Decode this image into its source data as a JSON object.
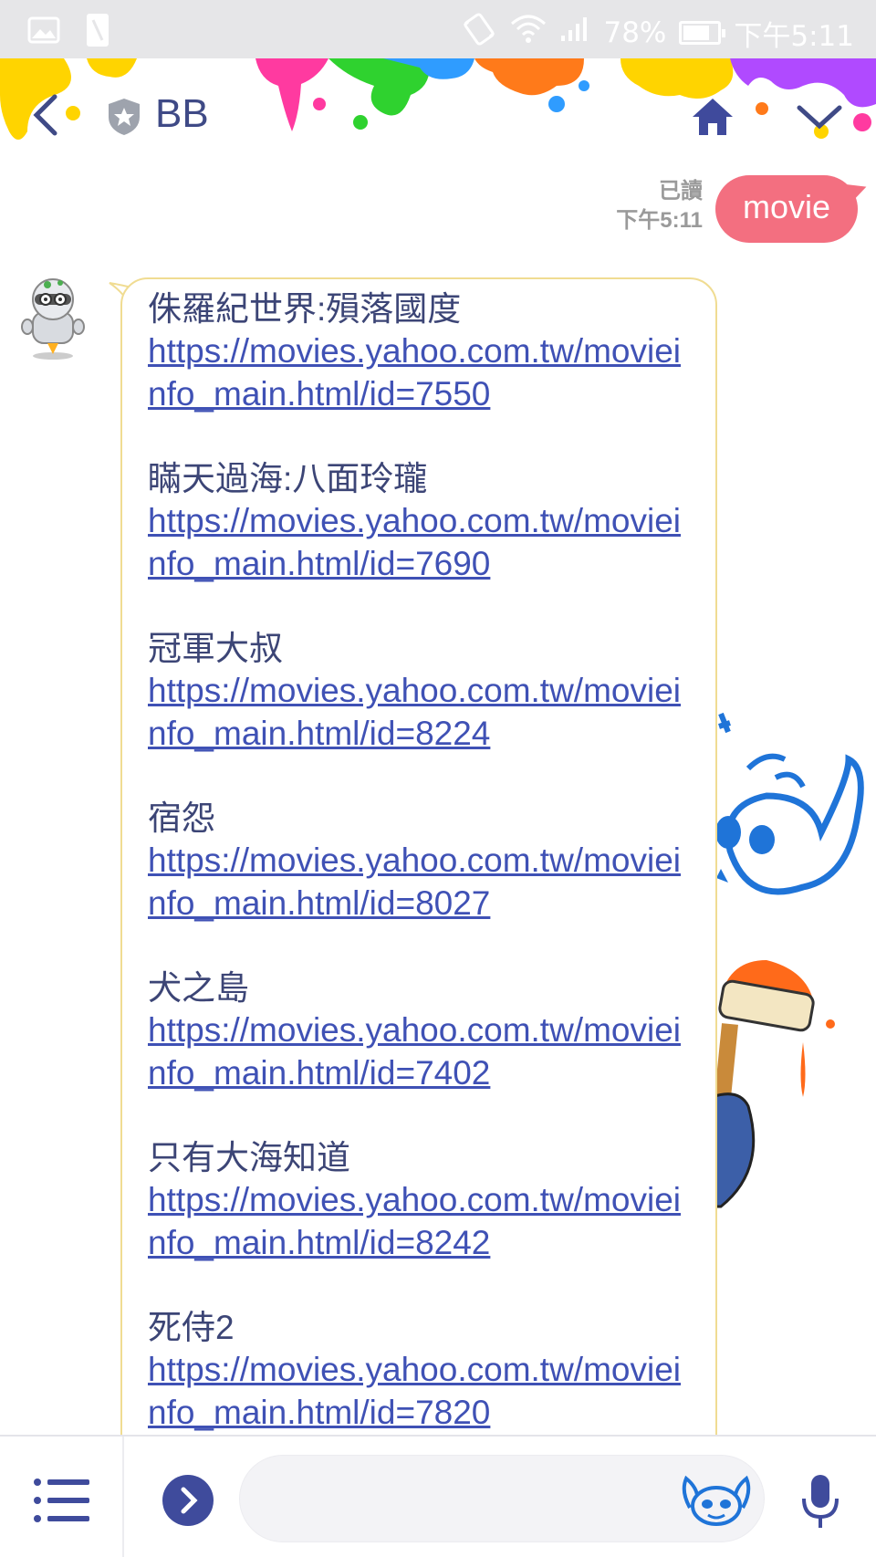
{
  "status_bar": {
    "battery_percent": "78%",
    "battery_level": 0.78,
    "time": "下午5:11",
    "icons": [
      "image-icon",
      "sim-icon",
      "vibrate-icon",
      "wifi-icon",
      "signal-icon",
      "battery-icon"
    ]
  },
  "header": {
    "title": "BB",
    "back_icon": "chevron-left-icon",
    "shield_icon": "shield-star-icon",
    "home_icon": "home-icon",
    "toggle_icon": "chevron-down-icon",
    "accent": "#3f4a86"
  },
  "messages": {
    "sent": {
      "text": "movie",
      "read_status": "已讀",
      "time": "下午5:11",
      "bubble_color": "#f36f80"
    },
    "received": {
      "bubble_border": "#f0dc92",
      "movies": [
        {
          "title": "侏羅紀世界:殞落國度",
          "link": "https://movies.yahoo.com.tw/movieinfo_main.html/id=7550"
        },
        {
          "title": "瞞天過海:八面玲瓏",
          "link": "https://movies.yahoo.com.tw/movieinfo_main.html/id=7690"
        },
        {
          "title": "冠軍大叔",
          "link": "https://movies.yahoo.com.tw/movieinfo_main.html/id=8224"
        },
        {
          "title": "宿怨",
          "link": "https://movies.yahoo.com.tw/movieinfo_main.html/id=8027"
        },
        {
          "title": "犬之島",
          "link": "https://movies.yahoo.com.tw/movieinfo_main.html/id=7402"
        },
        {
          "title": "只有大海知道",
          "link": "https://movies.yahoo.com.tw/movieinfo_main.html/id=8242"
        },
        {
          "title": "死侍2",
          "link": "https://movies.yahoo.com.tw/movieinfo_main.html/id=7820"
        }
      ]
    }
  },
  "input_bar": {
    "placeholder": "",
    "menu_icon": "list-menu-icon",
    "expand_icon": "chevron-right-circle-icon",
    "sticker_icon": "sticker-icon",
    "mic_icon": "microphone-icon",
    "accent": "#3f4b9c"
  }
}
